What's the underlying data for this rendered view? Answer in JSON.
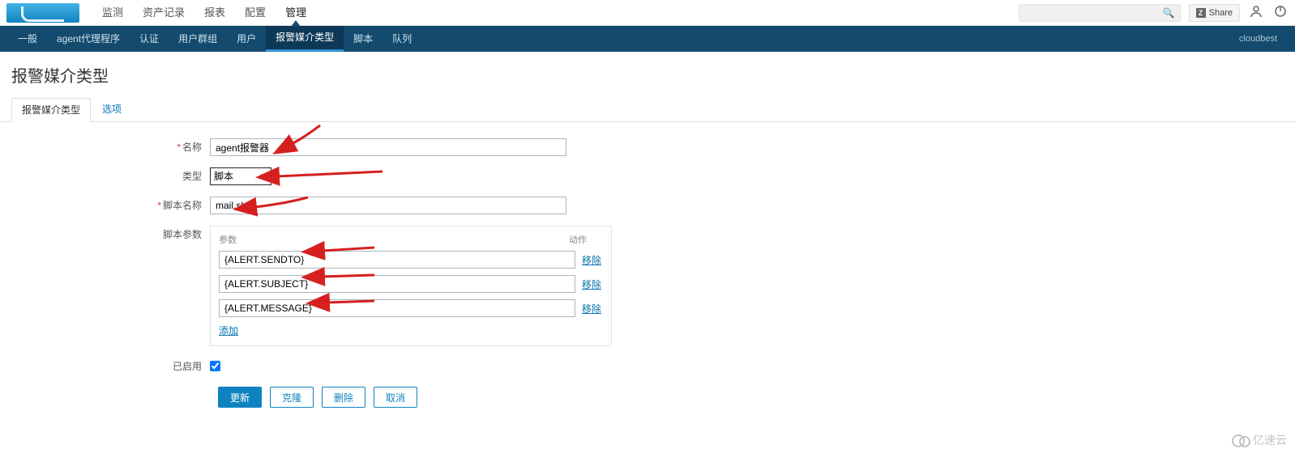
{
  "top_nav": {
    "items": [
      {
        "label": "监测"
      },
      {
        "label": "资产记录"
      },
      {
        "label": "报表"
      },
      {
        "label": "配置"
      },
      {
        "label": "管理",
        "active": true
      }
    ],
    "share_label": "Share"
  },
  "sub_nav": {
    "items": [
      {
        "label": "一般"
      },
      {
        "label": "agent代理程序"
      },
      {
        "label": "认证"
      },
      {
        "label": "用户群组"
      },
      {
        "label": "用户"
      },
      {
        "label": "报警媒介类型",
        "active": true
      },
      {
        "label": "脚本"
      },
      {
        "label": "队列"
      }
    ],
    "right_text": "cloudbest"
  },
  "page_title": "报警媒介类型",
  "inner_tabs": [
    {
      "label": "报警媒介类型",
      "active": true
    },
    {
      "label": "选项"
    }
  ],
  "form": {
    "name_label": "名称",
    "name_value": "agent报警器",
    "type_label": "类型",
    "type_value": "脚本",
    "script_name_label": "脚本名称",
    "script_name_value": "mail.sh",
    "script_params_label": "脚本参数",
    "params_header_param": "参数",
    "params_header_action": "动作",
    "params": [
      {
        "value": "{ALERT.SENDTO}"
      },
      {
        "value": "{ALERT.SUBJECT}"
      },
      {
        "value": "{ALERT.MESSAGE}"
      }
    ],
    "remove_label": "移除",
    "add_label": "添加",
    "enabled_label": "已启用",
    "enabled_checked": true
  },
  "buttons": {
    "update": "更新",
    "clone": "克隆",
    "delete": "删除",
    "cancel": "取消"
  },
  "watermark": "亿速云"
}
